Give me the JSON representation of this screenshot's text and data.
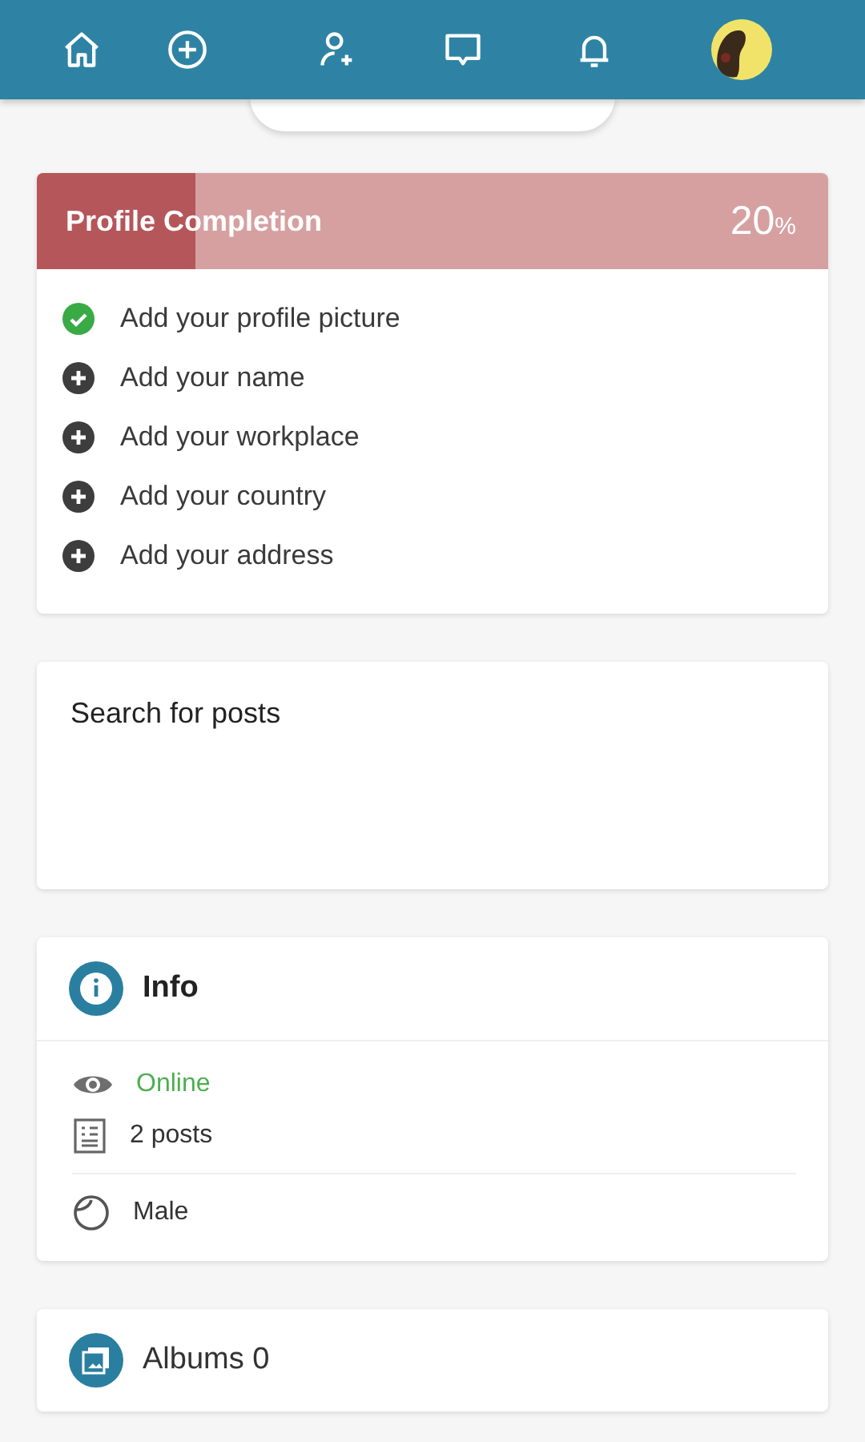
{
  "nav": {
    "items": [
      {
        "kind": "home"
      },
      {
        "kind": "add"
      },
      {
        "kind": "add-user"
      },
      {
        "kind": "messages"
      },
      {
        "kind": "notifications"
      }
    ]
  },
  "profile_completion": {
    "title": "Profile Completion",
    "value": "20",
    "unit": "%",
    "level": 0.2,
    "steps": [
      {
        "label": "Add your profile picture",
        "done": true
      },
      {
        "label": "Add your name",
        "done": false
      },
      {
        "label": "Add your workplace",
        "done": false
      },
      {
        "label": "Add your country",
        "done": false
      },
      {
        "label": "Add your address",
        "done": false
      }
    ]
  },
  "search": {
    "title": "Search for posts"
  },
  "info": {
    "title": "Info",
    "groups": [
      [
        {
          "kind": "status",
          "text": "Online"
        },
        {
          "kind": "posts",
          "text": "2 posts"
        }
      ],
      [
        {
          "kind": "gender",
          "text": "Male"
        }
      ]
    ]
  },
  "albums": {
    "title": "Albums 0"
  }
}
